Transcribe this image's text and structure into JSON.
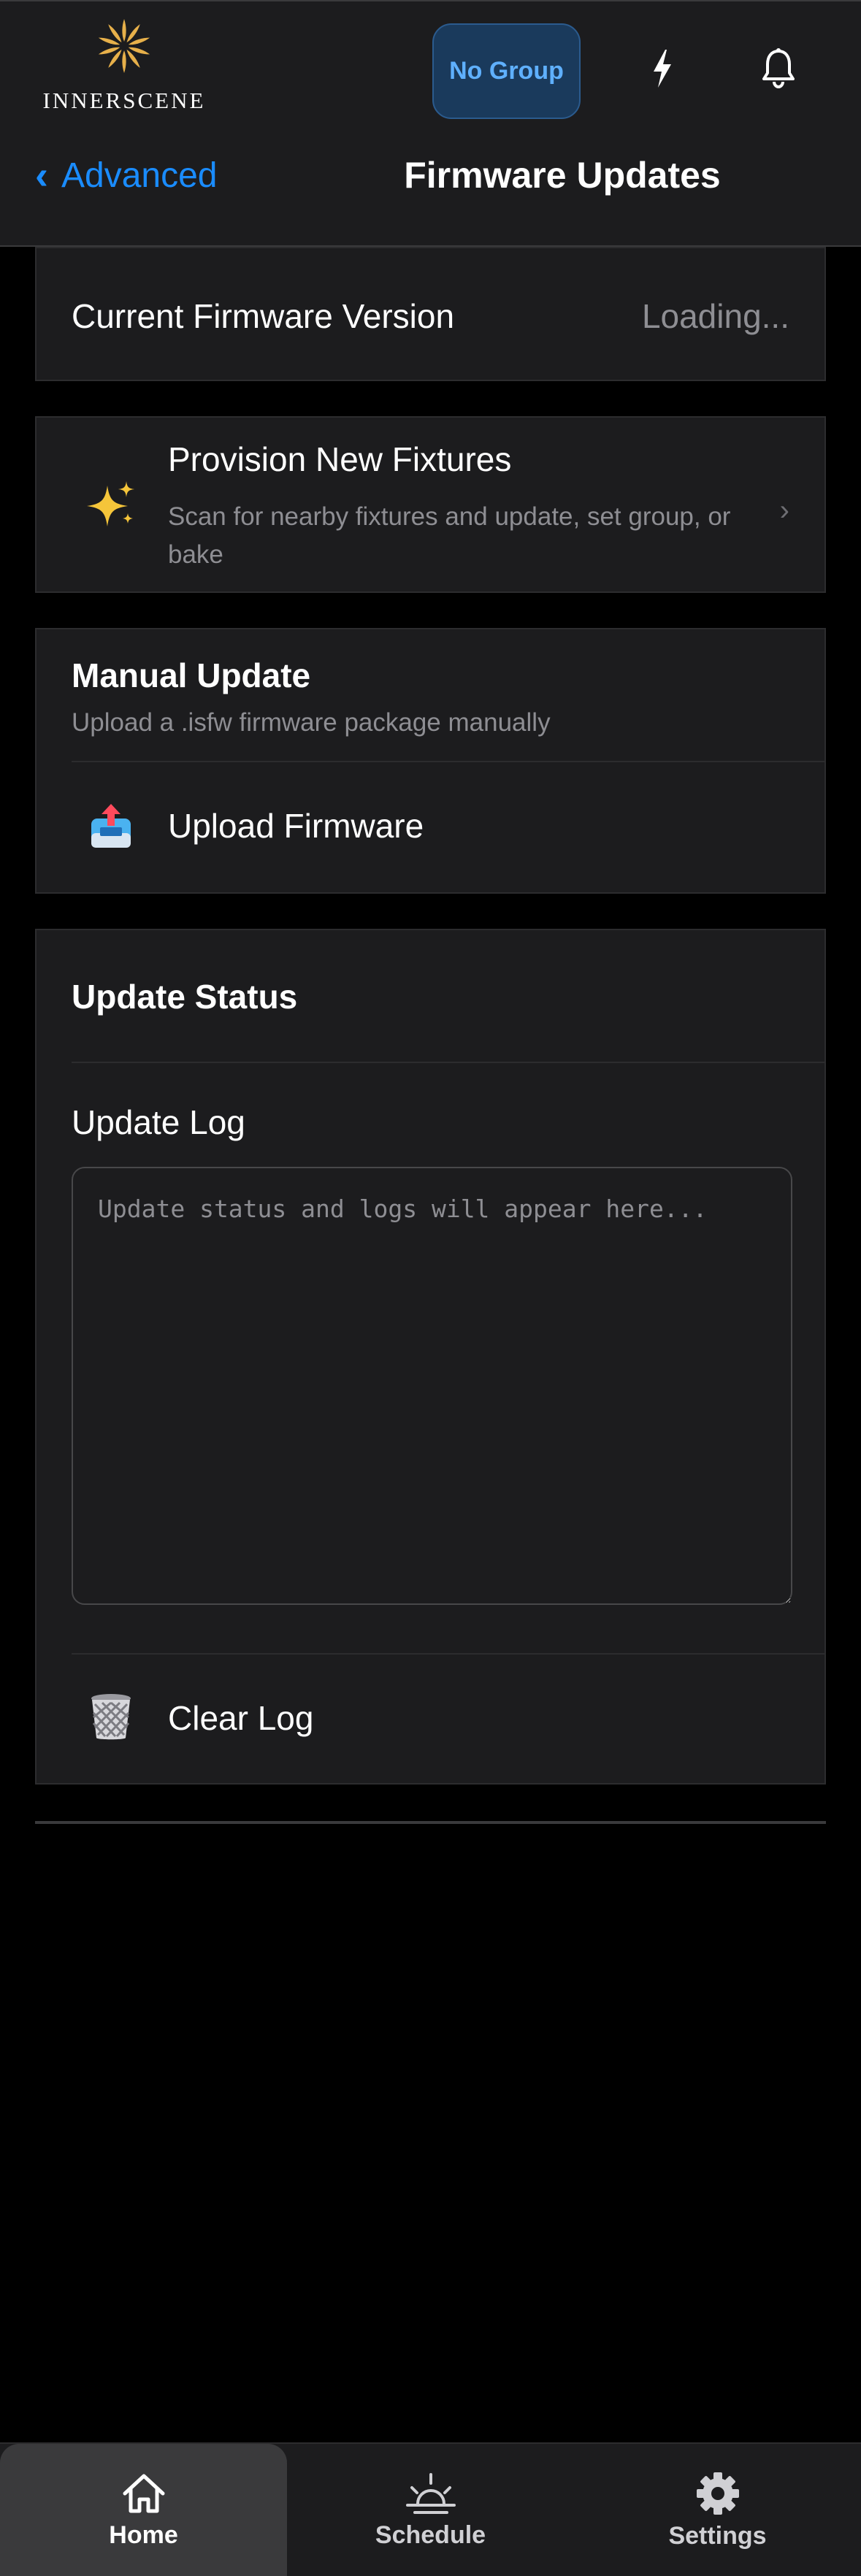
{
  "app": {
    "logo_text": "INNERSCENE",
    "group_button": "No Group",
    "icons": {
      "bolt": "bolt-icon",
      "bell": "bell-icon"
    }
  },
  "nav": {
    "back_label": "Advanced",
    "back_chevron": "‹",
    "title": "Firmware Updates"
  },
  "firmware": {
    "label": "Current Firmware Version",
    "value": "Loading..."
  },
  "provision": {
    "icon": "sparkles-icon",
    "title": "Provision New Fixtures",
    "description": "Scan for nearby fixtures and update, set group, or bake",
    "chevron": "›"
  },
  "manual_update": {
    "title": "Manual Update",
    "subtitle": "Upload a .isfw firmware package manually",
    "upload_label": "Upload Firmware",
    "upload_icon": "upload-tray-icon"
  },
  "update_status": {
    "title": "Update Status",
    "log_label": "Update Log",
    "log_placeholder": "Update status and logs will appear here...",
    "clear_label": "Clear Log",
    "clear_icon": "wastebasket-icon"
  },
  "tabs": [
    {
      "label": "Home",
      "icon": "home-icon",
      "active": true
    },
    {
      "label": "Schedule",
      "icon": "sunrise-icon",
      "active": false
    },
    {
      "label": "Settings",
      "icon": "gear-icon",
      "active": false
    }
  ],
  "colors": {
    "accent": "#1a8cff",
    "background": "#000000",
    "card": "#1c1c1e",
    "secondary_text": "#8e8e93",
    "logo_gold": "#e7b04a"
  }
}
